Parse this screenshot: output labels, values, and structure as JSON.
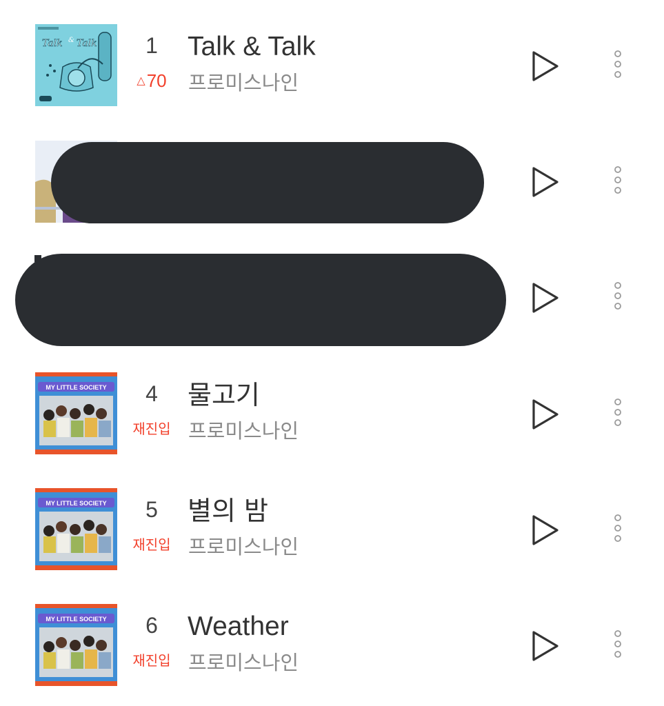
{
  "colors": {
    "rank_change": "#f2402b",
    "title_text": "#333333",
    "artist_text": "#8a8a8a",
    "icon_stroke": "#333333",
    "more_dots": "#9a9a9a",
    "redaction": "#2a2d31"
  },
  "icons": {
    "play": "play-icon",
    "more": "more-vertical-icon",
    "rank_up": "triangle-up-icon"
  },
  "songs": [
    {
      "rank": "1",
      "change_symbol": "△",
      "change_value": "70",
      "title": "Talk & Talk",
      "artist": "프로미스나인",
      "album_art": "talk-and-talk-album-cover"
    },
    {
      "album_art": "redacted-album-cover"
    },
    {},
    {
      "rank": "4",
      "change_label": "재진입",
      "title": "물고기",
      "artist": "프로미스나인",
      "album_art": "my-little-society-album-cover",
      "album_text": "MY LITTLE SOCIETY"
    },
    {
      "rank": "5",
      "change_label": "재진입",
      "title": "별의 밤",
      "artist": "프로미스나인",
      "album_art": "my-little-society-album-cover",
      "album_text": "MY LITTLE SOCIETY"
    },
    {
      "rank": "6",
      "change_label": "재진입",
      "title": "Weather",
      "artist": "프로미스나인",
      "album_art": "my-little-society-album-cover",
      "album_text": "MY LITTLE SOCIETY"
    }
  ]
}
